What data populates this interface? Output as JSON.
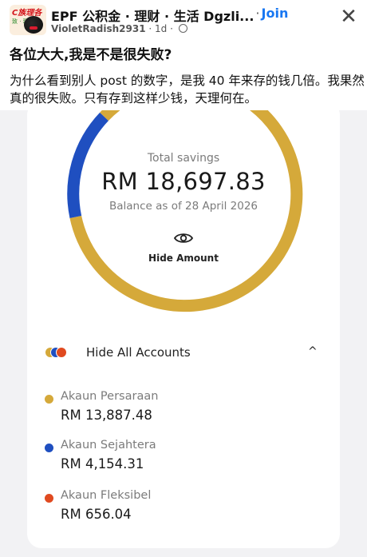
{
  "header": {
    "avatar_text_1": "C族理各",
    "avatar_text_2": "致 · 理",
    "group_name": "EPF 公积金 · 理财 · 生活 Dgzli...",
    "separator": "·",
    "join_label": "Join",
    "username": "VioletRadish2931",
    "time": "1d",
    "close_glyph": "✕"
  },
  "post": {
    "title": "各位大大,我是不是很失败?",
    "body": "为什么看到别人 post 的数字，是我 40 年来存的钱几倍。我果然真的很失败。只有存到这样少钱，天理何在。"
  },
  "epf": {
    "total_label": "Total savings",
    "total_value": "RM 18,697.83",
    "balance_date": "Balance as of 28 April 2026",
    "hide_amount_label": "Hide Amount",
    "hide_all_label": "Hide All Accounts",
    "chevron": "^",
    "accounts": [
      {
        "name": "Akaun Persaraan",
        "amount": "RM 13,887.48",
        "color": "#d5a93a"
      },
      {
        "name": "Akaun Sejahtera",
        "amount": "RM 4,154.31",
        "color": "#1f4fc0"
      },
      {
        "name": "Akaun Fleksibel",
        "amount": "RM 656.04",
        "color": "#e04a20"
      }
    ],
    "ring_colors": {
      "gold": "#d5a93a",
      "blue": "#1f4fc0",
      "orange": "#e04a20"
    }
  }
}
